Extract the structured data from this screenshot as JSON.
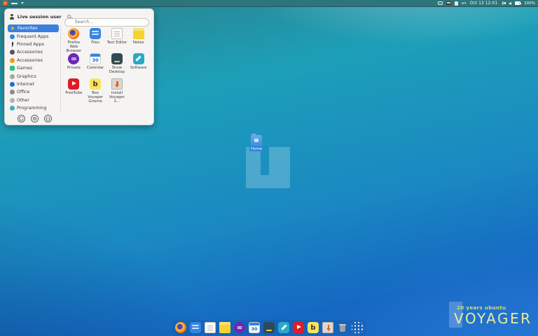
{
  "panel": {
    "keyboard_layout": "en",
    "clock": "Oct 13 12:01",
    "battery": "100%"
  },
  "menu": {
    "user_name": "Live session user",
    "search_placeholder": "Search...",
    "categories": [
      {
        "label": "Favorites",
        "icon": "star",
        "color": "#f5c211",
        "selected": true
      },
      {
        "label": "Frequent Apps",
        "icon": "dot",
        "color": "#3584e4",
        "selected": false
      },
      {
        "label": "Pinned Apps",
        "icon": "pin",
        "color": "#3d3846",
        "selected": false
      },
      {
        "label": "Accessories",
        "icon": "dot",
        "color": "#55525c",
        "selected": false
      },
      {
        "label": "Accessories",
        "icon": "dot",
        "color": "#f59817",
        "selected": false
      },
      {
        "label": "Games",
        "icon": "sq",
        "color": "#2ec27e",
        "selected": false
      },
      {
        "label": "Graphics",
        "icon": "dot",
        "color": "#a8a6a2",
        "selected": false
      },
      {
        "label": "Internet",
        "icon": "dot",
        "color": "#1c71d8",
        "selected": false
      },
      {
        "label": "Office",
        "icon": "dot",
        "color": "#8e8c89",
        "selected": false
      },
      {
        "label": "Other",
        "icon": "dot",
        "color": "#b5b3af",
        "selected": false
      },
      {
        "label": "Programming",
        "icon": "dot",
        "color": "#36b2c4",
        "selected": false
      }
    ],
    "apps": [
      {
        "label": "Firefox Web Browser",
        "icon": "firefox"
      },
      {
        "label": "Files",
        "icon": "files"
      },
      {
        "label": "Text Editor",
        "icon": "text-editor"
      },
      {
        "label": "Notes",
        "icon": "notes"
      },
      {
        "label": "Private",
        "icon": "private"
      },
      {
        "label": "Calendar",
        "icon": "calendar"
      },
      {
        "label": "Show Desktop",
        "icon": "show-desktop"
      },
      {
        "label": "Software",
        "icon": "software"
      },
      {
        "label": "FreeTube",
        "icon": "freetube"
      },
      {
        "label": "Box Voyager Gnome",
        "icon": "box-voyager"
      },
      {
        "label": "Install Voyager 2...",
        "icon": "install-voyager"
      }
    ],
    "footer_buttons": [
      {
        "name": "logout"
      },
      {
        "name": "settings"
      },
      {
        "name": "power"
      }
    ]
  },
  "desktop": {
    "home_label": "Home",
    "watermark_line1": "20 years ubuntu",
    "watermark_line2": "VOYAGER"
  },
  "dock": {
    "items": [
      "firefox",
      "files",
      "text-editor",
      "notes",
      "private",
      "calendar",
      "show-desktop",
      "software",
      "freetube",
      "box-voyager",
      "install-voyager",
      "trash",
      "app-grid"
    ]
  },
  "glyphs": {
    "calendar_day": "30",
    "private_glyph": "∞",
    "box_voyager_glyph": "b"
  },
  "colors": {
    "panel": "#2c757b",
    "menu_selected": "#3b80dd",
    "accent_blue": "#3584e4",
    "watermark_yellow": "#e9eb9e"
  }
}
